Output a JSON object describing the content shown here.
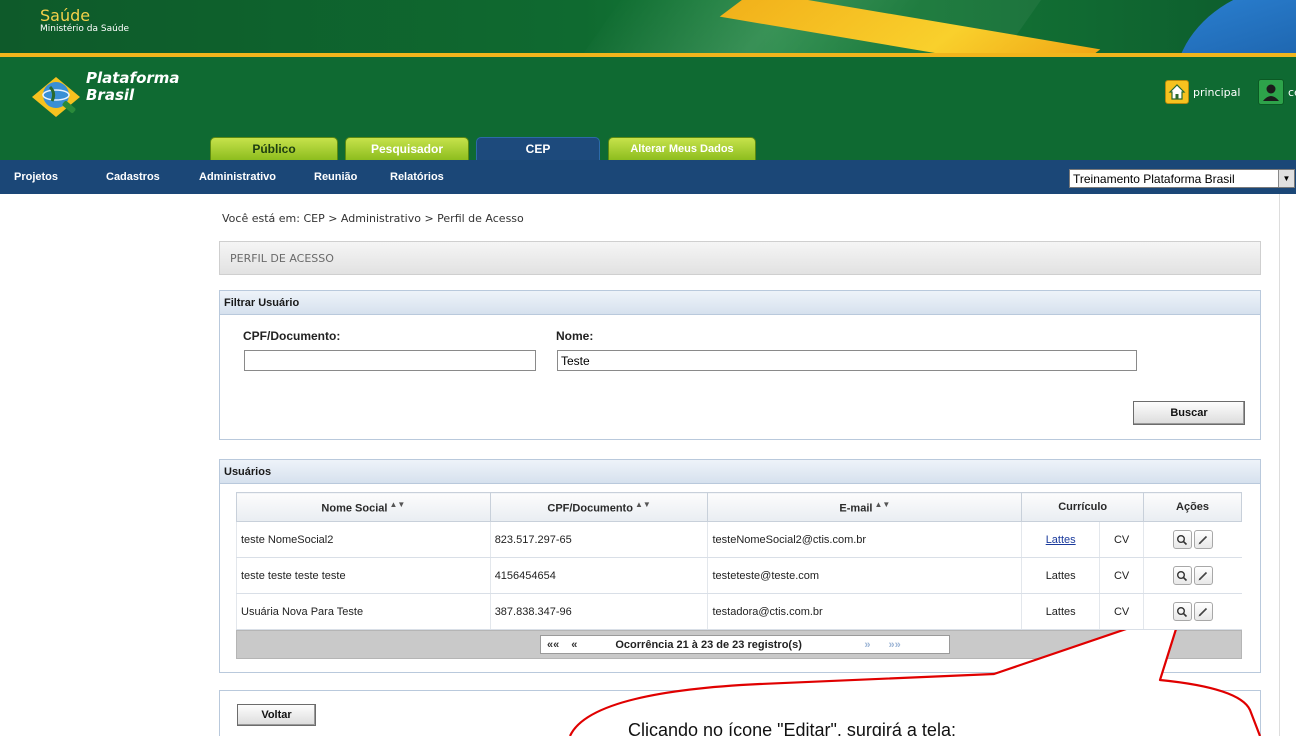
{
  "gov_bar": {
    "title": "Saúde",
    "subtitle": "Ministério da Saúde"
  },
  "app": {
    "logo_line1": "Plataforma",
    "logo_line2": "Brasil"
  },
  "header_links": {
    "home": "principal",
    "center": "cent"
  },
  "tabs": [
    {
      "label": "Público"
    },
    {
      "label": "Pesquisador"
    },
    {
      "label": "CEP"
    },
    {
      "label": "Alterar Meus Dados"
    }
  ],
  "nav": {
    "items": [
      {
        "label": "Projetos"
      },
      {
        "label": "Cadastros"
      },
      {
        "label": "Administrativo"
      },
      {
        "label": "Reunião"
      },
      {
        "label": "Relatórios"
      }
    ],
    "institution_selected": "Treinamento Plataforma Brasil"
  },
  "breadcrumb": "Você está em: CEP > Administrativo > Perfil de Acesso",
  "page_title": "PERFIL DE ACESSO",
  "filter": {
    "title": "Filtrar Usuário",
    "cpf_label": "CPF/Documento:",
    "cpf_value": "",
    "nome_label": "Nome:",
    "nome_value": "Teste",
    "search_label": "Buscar"
  },
  "users": {
    "title": "Usuários",
    "columns": {
      "nome_social": "Nome Social",
      "cpf": "CPF/Documento",
      "email": "E-mail",
      "curriculo": "Currículo",
      "acoes": "Ações"
    },
    "rows": [
      {
        "nome": "teste NomeSocial2",
        "cpf": "823.517.297-65",
        "email": "testeNomeSocial2@ctis.com.br",
        "lattes": "Lattes",
        "cv": "CV"
      },
      {
        "nome": "teste teste teste teste",
        "cpf": "4156454654",
        "email": "testeteste@teste.com",
        "lattes": "Lattes",
        "cv": "CV"
      },
      {
        "nome": "Usuária Nova Para Teste",
        "cpf": "387.838.347-96",
        "email": "testadora@ctis.com.br",
        "lattes": "Lattes",
        "cv": "CV"
      }
    ],
    "pager": {
      "first": "««",
      "prev": "«",
      "info": "Ocorrência 21 à 23 de 23 registro(s)",
      "next": "»",
      "last": "»»"
    }
  },
  "back_label": "Voltar",
  "callout": {
    "text": "Clicando no ícone \"Editar\", surgirá a tela:"
  },
  "colors": {
    "nav_blue": "#1b4777",
    "header_green": "#0f6a32",
    "accent_gold": "#f1b51c",
    "callout_red": "#e00000"
  }
}
